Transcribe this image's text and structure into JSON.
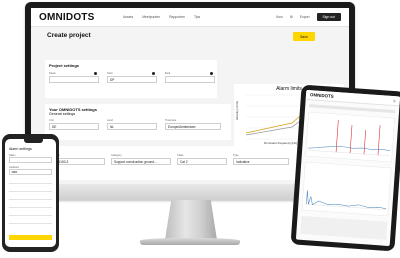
{
  "monitor": {
    "nav": {
      "logo": "OMNIDOTS",
      "items": [
        "Assets",
        "Meetpunten",
        "Rapporten",
        "Tips"
      ],
      "right_items": [
        "Ikon",
        "Export"
      ],
      "signout": "Sign out"
    },
    "page_title": "Create project",
    "save_label": "Save",
    "project_settings": {
      "title": "Project settings",
      "fields": [
        {
          "label": "Naam",
          "value": ""
        },
        {
          "label": "Start",
          "value": "DP"
        },
        {
          "label": "Eind",
          "value": ""
        }
      ]
    },
    "omnidots_settings": {
      "title": "Your OMNIDOTS settings",
      "subtitle": "General settings",
      "fields": [
        {
          "label": "Unit",
          "value": "DE"
        },
        {
          "label": "Land",
          "value": "NL"
        },
        {
          "label": "Timezone",
          "value": "Europe/Amsterdam"
        }
      ]
    },
    "alarm_settings": {
      "fields": [
        {
          "label": "Guideline",
          "value": "DIN 4150-3"
        },
        {
          "label": "Category",
          "value": "Support construction ground..."
        },
        {
          "label": "Class",
          "value": "Cat 2"
        },
        {
          "label": "Type",
          "value": "Indicative"
        }
      ]
    },
    "chart": {
      "title": "Alarm limits",
      "ylabel": "Velocity (mm/s)",
      "xlabel": "Dominant frequency [Hz]"
    }
  },
  "phone": {
    "title": "Alarm settings",
    "fields": [
      {
        "label": "Naam",
        "value": ""
      },
      {
        "label": "Guideline",
        "value": "SBR"
      }
    ]
  },
  "tablet": {
    "logo": "OMNIDOTS"
  },
  "chart_data": {
    "type": "line",
    "title": "Alarm limits",
    "xlabel": "Dominant frequency [Hz]",
    "ylabel": "Velocity (mm/s)",
    "series": [
      {
        "values": [
          3,
          8,
          14,
          18,
          19,
          20,
          20,
          20
        ]
      },
      {
        "values": [
          2,
          6,
          11,
          15,
          17,
          18,
          18,
          18
        ]
      }
    ],
    "x": [
      1,
      10,
      20,
      30,
      40,
      50,
      70,
      100
    ]
  }
}
